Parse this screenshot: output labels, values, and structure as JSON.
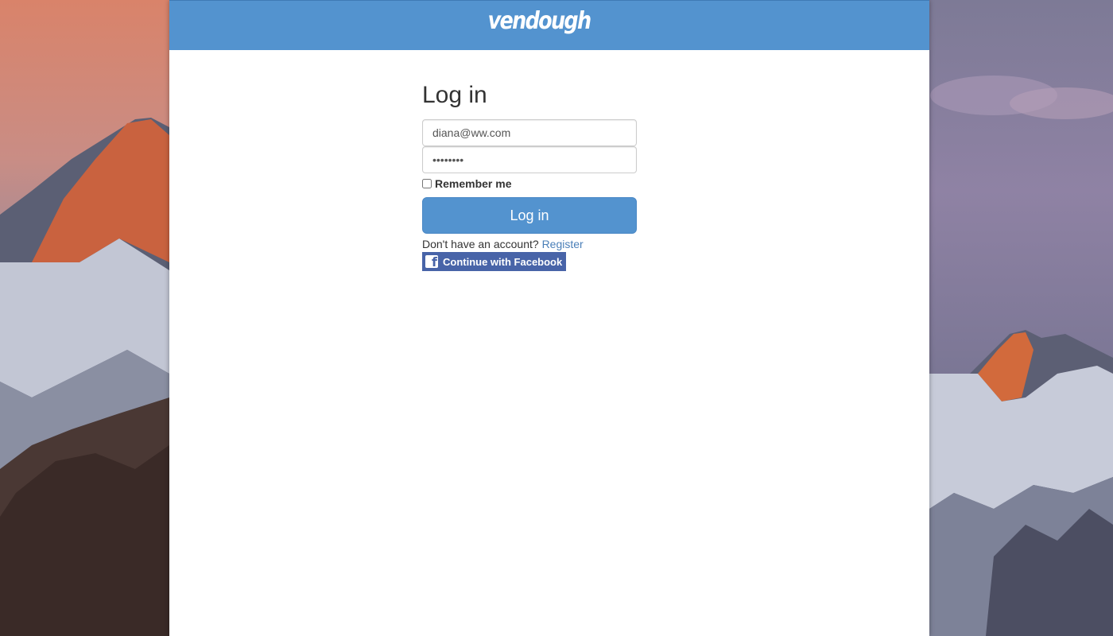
{
  "brand": {
    "logo_text": "vendough"
  },
  "login": {
    "title": "Log in",
    "email_value": "diana@ww.com",
    "password_value": "diana123",
    "remember_label": "Remember me",
    "remember_checked": false,
    "submit_label": "Log in",
    "no_account_text": "Don't have an account?",
    "register_link": "Register",
    "facebook_label": "Continue with Facebook",
    "facebook_icon": "facebook-f-icon"
  },
  "colors": {
    "brand_blue": "#5393cf",
    "facebook_blue": "#4864a8",
    "link_blue": "#4a7fb8"
  }
}
